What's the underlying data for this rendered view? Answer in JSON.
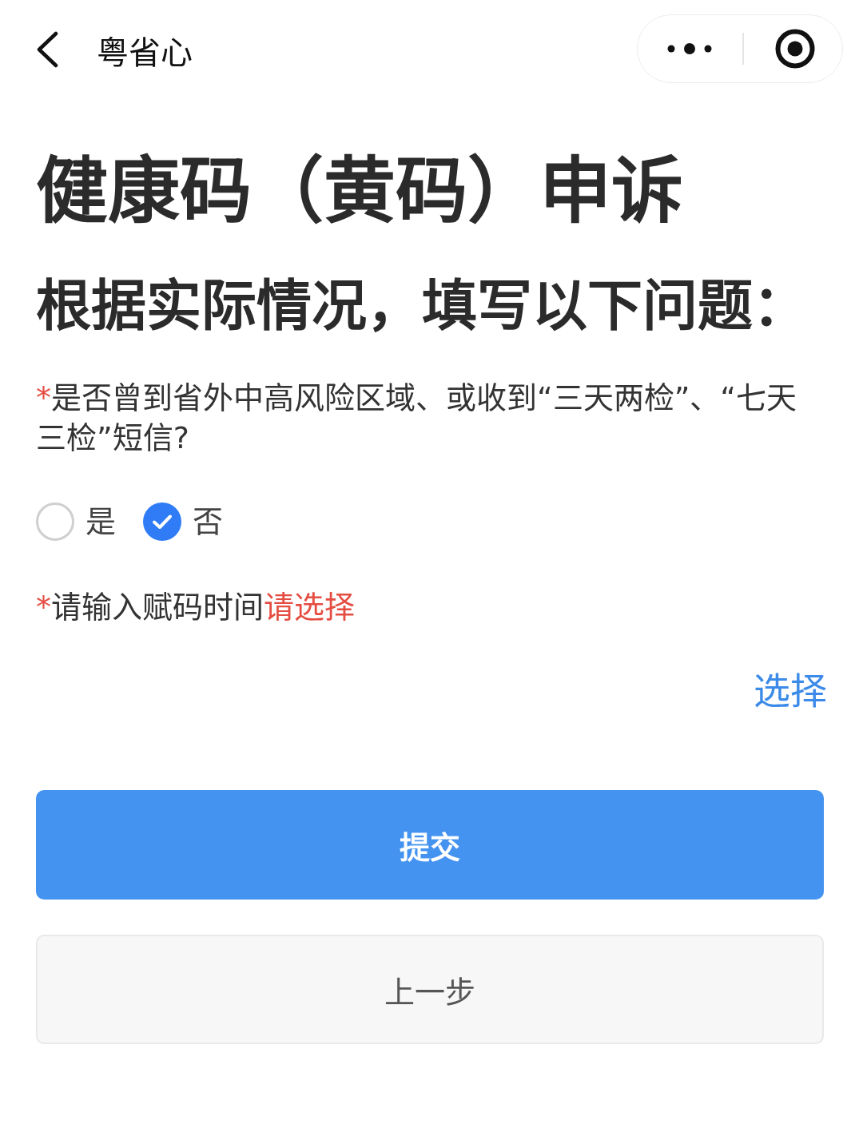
{
  "nav_bar": {
    "title": "粤省心"
  },
  "page_title": "健康码（黄码）申诉",
  "subtitle": "根据实际情况，填写以下问题：",
  "questions": [
    {
      "kind": "radio",
      "required_mark": "*",
      "label": "是否曾到省外中高风险区域、或收到“三天两检”、“七天三检”短信?",
      "options": [
        {
          "label": "是",
          "selected": false
        },
        {
          "label": "否",
          "selected": true
        }
      ]
    },
    {
      "kind": "picker",
      "required_mark": "*",
      "label": "请输入赋码时间",
      "prompt": "请选择",
      "action": "选择"
    }
  ],
  "buttons": [
    {
      "kind": "primary",
      "label": "提交"
    },
    {
      "kind": "secondary",
      "label": "上一步"
    }
  ]
}
